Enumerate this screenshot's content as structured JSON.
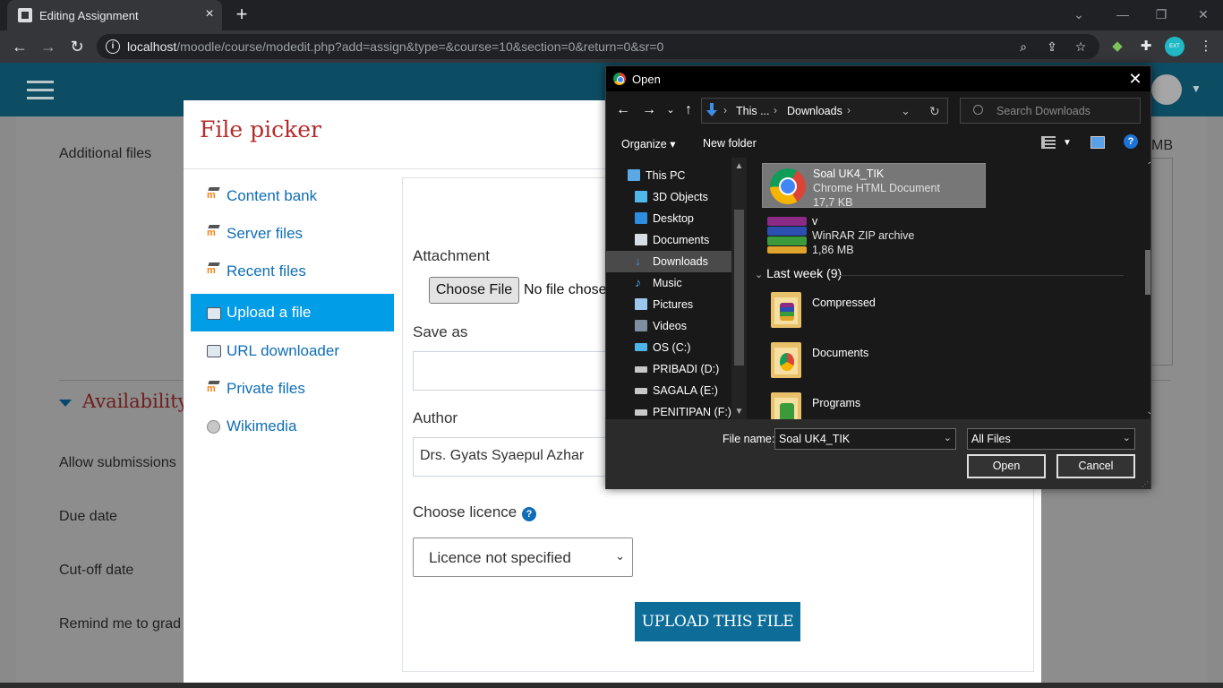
{
  "browser": {
    "tab_title": "Editing Assignment",
    "tab_close": "×",
    "new_tab": "+",
    "url_host": "localhost",
    "url_path": "/moodle/course/modedit.php?add=assign&type=&course=10&section=0&return=0&sr=0",
    "profile_badge": "EXT"
  },
  "moodle_bg": {
    "additional_files": "Additional files",
    "availability": "Availability",
    "allow_submissions": "Allow submissions",
    "due_date": "Due date",
    "cutoff_date": "Cut-off date",
    "remind": "Remind me to grad",
    "mb_suffix": "MB"
  },
  "file_picker": {
    "title": "File picker",
    "nav": [
      {
        "label": "Content bank",
        "icon": "moodle-icon"
      },
      {
        "label": "Server files",
        "icon": "moodle-icon"
      },
      {
        "label": "Recent files",
        "icon": "moodle-icon"
      },
      {
        "label": "Upload a file",
        "icon": "upload-icon",
        "active": true
      },
      {
        "label": "URL downloader",
        "icon": "download-icon"
      },
      {
        "label": "Private files",
        "icon": "moodle-icon"
      },
      {
        "label": "Wikimedia",
        "icon": "globe-icon"
      }
    ],
    "attachment_label": "Attachment",
    "choose_file": "Choose File",
    "no_file": "No file chose",
    "save_as_label": "Save as",
    "save_as_value": "",
    "author_label": "Author",
    "author_value": "Drs. Gyats Syaepul Azhar",
    "licence_label": "Choose licence",
    "licence_value": "Licence not specified",
    "upload_button": "UPLOAD THIS FILE"
  },
  "open_dialog": {
    "title": "Open",
    "close": "✕",
    "breadcrumb": [
      "This ...",
      "Downloads"
    ],
    "search_placeholder": "Search Downloads",
    "organize": "Organize",
    "new_folder": "New folder",
    "help": "?",
    "tree": [
      {
        "label": "This PC",
        "icon": "pc-icon"
      },
      {
        "label": "3D Objects",
        "icon": "3d-objects-icon"
      },
      {
        "label": "Desktop",
        "icon": "desktop-icon"
      },
      {
        "label": "Documents",
        "icon": "documents-icon"
      },
      {
        "label": "Downloads",
        "icon": "downloads-icon",
        "selected": true
      },
      {
        "label": "Music",
        "icon": "music-icon"
      },
      {
        "label": "Pictures",
        "icon": "pictures-icon"
      },
      {
        "label": "Videos",
        "icon": "videos-icon"
      },
      {
        "label": "OS (C:)",
        "icon": "os-drive-icon"
      },
      {
        "label": "PRIBADI (D:)",
        "icon": "drive-icon"
      },
      {
        "label": "SAGALA (E:)",
        "icon": "drive-icon"
      },
      {
        "label": "PENITIPAN (F:)",
        "icon": "drive-icon"
      }
    ],
    "files_recent": [
      {
        "name": "Soal UK4_TIK",
        "type": "Chrome HTML Document",
        "size": "17,7 KB",
        "selected": true
      },
      {
        "name": "v",
        "type": "WinRAR ZIP archive",
        "size": "1,86 MB"
      }
    ],
    "group_last_week": "Last week (9)",
    "folders": [
      "Compressed",
      "Documents",
      "Programs"
    ],
    "file_name_label": "File name:",
    "file_name_value": "Soal UK4_TIK",
    "file_type_value": "All Files",
    "open_button": "Open",
    "cancel_button": "Cancel"
  },
  "colors": {
    "moodle_nav": "#0d4d63",
    "picker_active": "#019de6",
    "picker_link": "#0f6eb6",
    "picker_title": "#b42c2c",
    "upload_button": "#0d6c98",
    "dialog_bg": "#191919"
  }
}
